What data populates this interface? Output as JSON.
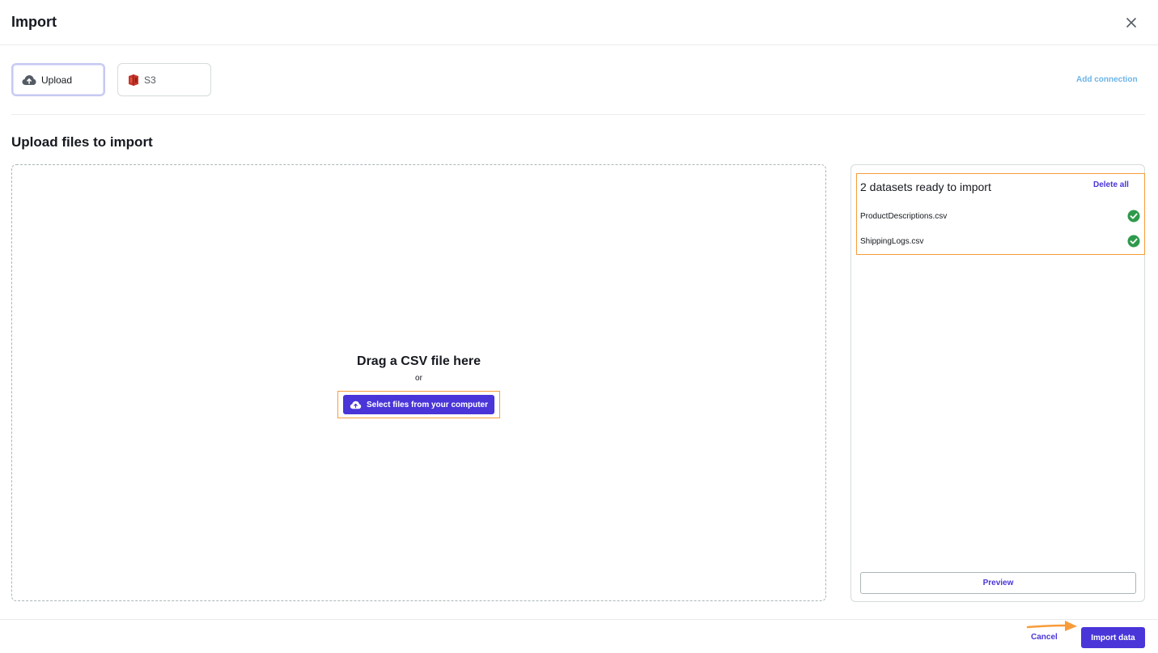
{
  "dialog": {
    "title": "Import"
  },
  "sources": {
    "tabs": [
      {
        "label": "Upload",
        "icon": "cloud-upload-icon",
        "selected": true
      },
      {
        "label": "S3",
        "icon": "s3-bucket-icon",
        "selected": false
      }
    ],
    "add_connection_label": "Add connection"
  },
  "upload": {
    "section_title": "Upload files to import",
    "drop_title": "Drag a CSV file here",
    "or_label": "or",
    "select_button_label": "Select files from your computer"
  },
  "datasets": {
    "title": "2 datasets ready to import",
    "delete_all_label": "Delete all",
    "files": [
      {
        "name": "ProductDescriptions.csv",
        "status": "ready"
      },
      {
        "name": "ShippingLogs.csv",
        "status": "ready"
      }
    ],
    "preview_label": "Preview"
  },
  "footer": {
    "cancel_label": "Cancel",
    "import_label": "Import data"
  },
  "colors": {
    "accent": "#4935d8",
    "highlight": "#f89c3a",
    "success": "#2e9a4b",
    "link": "#6cb4e8"
  }
}
